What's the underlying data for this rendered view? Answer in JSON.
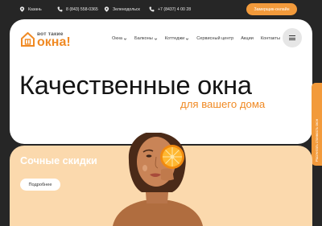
{
  "topbar": {
    "city": "Казань",
    "phone1": "8 (843) 558-0365",
    "city2": "Зеленодольск",
    "phone2": "+7 (8437) 4 00 28",
    "cta": "Замерщик-онлайн",
    "icons": [
      "location-pin-icon",
      "phone-icon",
      "location-pin-icon",
      "phone-icon"
    ]
  },
  "logo": {
    "line1": "вот такие",
    "line2": "окна!"
  },
  "nav": {
    "items": [
      {
        "label": "Окна",
        "has_dropdown": true
      },
      {
        "label": "Балконы",
        "has_dropdown": true
      },
      {
        "label": "Коттеджи",
        "has_dropdown": true
      },
      {
        "label": "Сервисный центр",
        "has_dropdown": false
      },
      {
        "label": "Акции",
        "has_dropdown": false
      },
      {
        "label": "Контакты",
        "has_dropdown": false
      }
    ],
    "menu_icon": "burger-menu-icon"
  },
  "hero": {
    "headline": "Качественные окна",
    "subline": "для вашего дома"
  },
  "sidetab": {
    "label": "Рассчитать стоимость окон"
  },
  "promo": {
    "title": "Сочные скидки",
    "button": "Подробнее"
  },
  "colors": {
    "background": "#262626",
    "accent": "#f29a3b",
    "accent_text": "#f08a24",
    "promo_bg": "#fbd9ad"
  }
}
